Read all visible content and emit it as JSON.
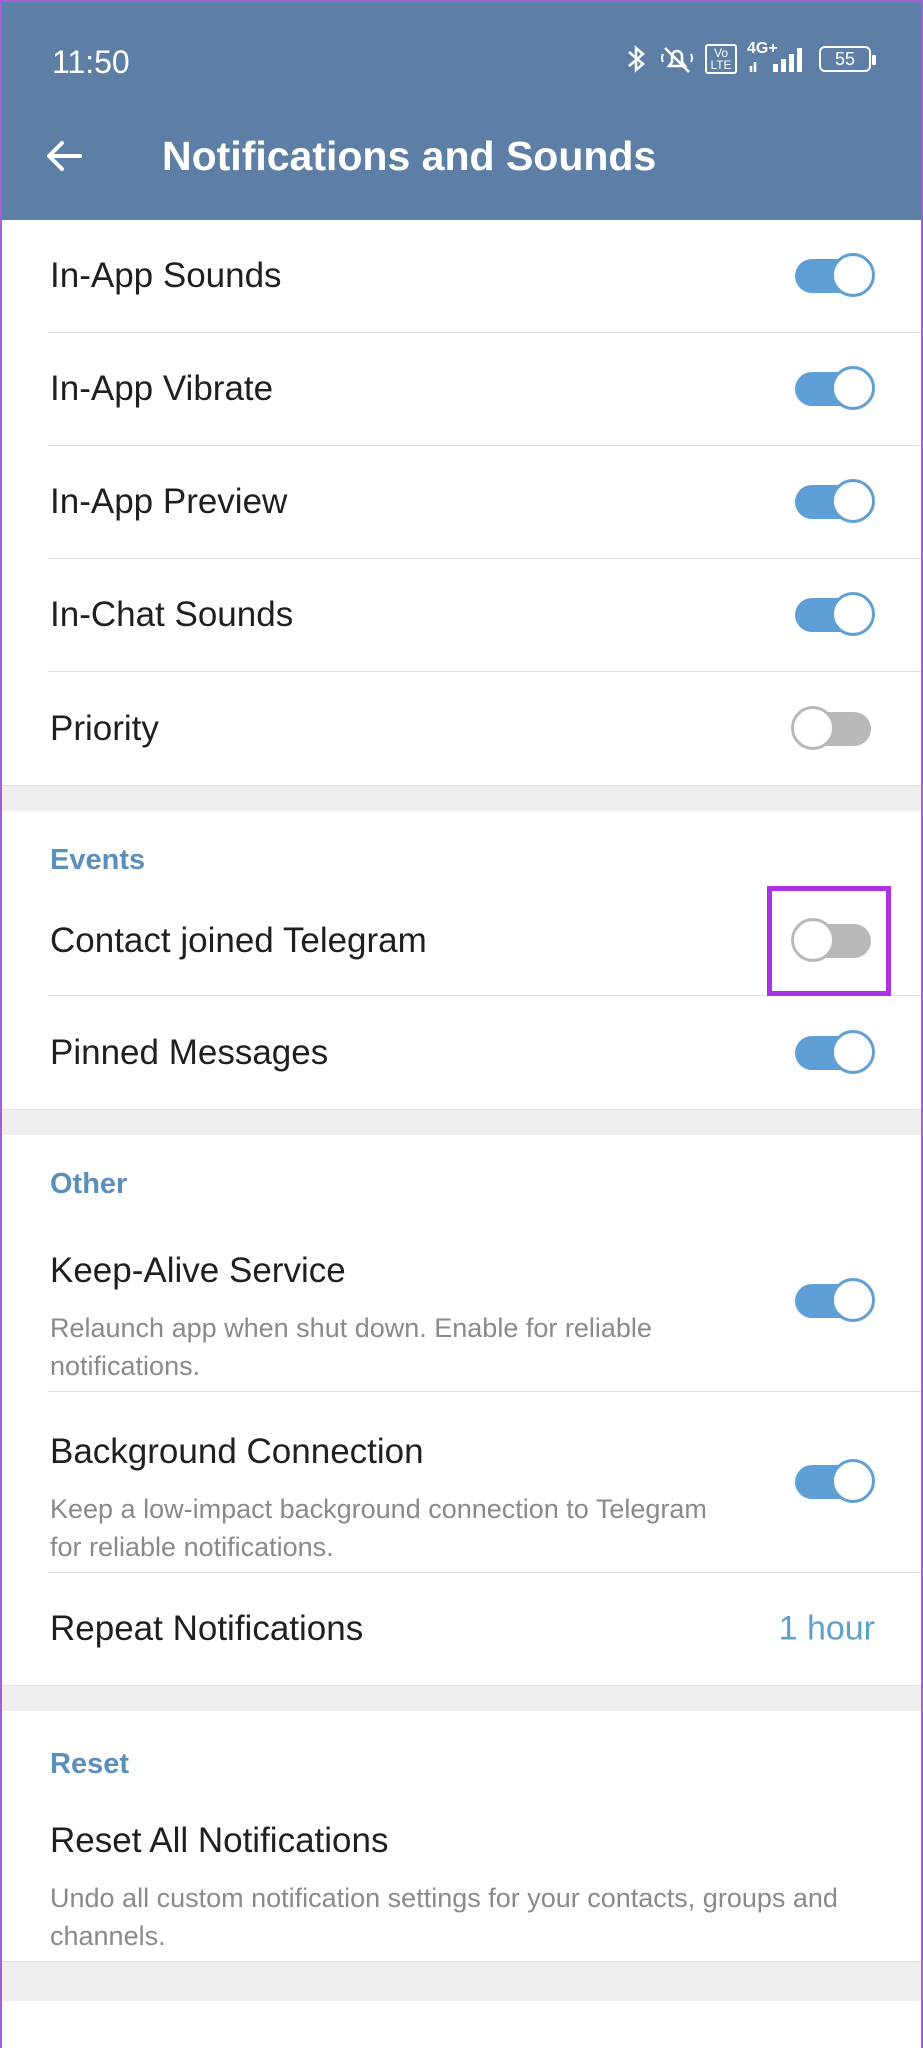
{
  "status_bar": {
    "time": "11:50",
    "icons": [
      "bluetooth-icon",
      "mute-icon",
      "volte-icon",
      "4g-signal-icon",
      "battery-icon"
    ],
    "network_badge": "4G+",
    "volte_badge": "Vo LTE",
    "battery_level": "55"
  },
  "header": {
    "title": "Notifications and Sounds",
    "back_icon": "arrow-left-icon"
  },
  "in_app": {
    "items": [
      {
        "label": "In-App Sounds",
        "enabled": true
      },
      {
        "label": "In-App Vibrate",
        "enabled": true
      },
      {
        "label": "In-App Preview",
        "enabled": true
      },
      {
        "label": "In-Chat Sounds",
        "enabled": true
      },
      {
        "label": "Priority",
        "enabled": false
      }
    ]
  },
  "events": {
    "header": "Events",
    "items": [
      {
        "label": "Contact joined Telegram",
        "enabled": false,
        "highlighted": true
      },
      {
        "label": "Pinned Messages",
        "enabled": true
      }
    ]
  },
  "other": {
    "header": "Other",
    "keep_alive": {
      "label": "Keep-Alive Service",
      "description": "Relaunch app when shut down. Enable for reliable notifications.",
      "enabled": true
    },
    "background": {
      "label": "Background Connection",
      "description": "Keep a low-impact background connection to Telegram for reliable notifications.",
      "enabled": true
    },
    "repeat": {
      "label": "Repeat Notifications",
      "value": "1 hour"
    }
  },
  "reset": {
    "header": "Reset",
    "label": "Reset All Notifications",
    "description": "Undo all custom notification settings for your contacts, groups and channels."
  },
  "colors": {
    "appbar": "#5d7fa5",
    "accent": "#5ea0d6",
    "section_header": "#5b8fbb",
    "highlight": "#a932e6"
  }
}
